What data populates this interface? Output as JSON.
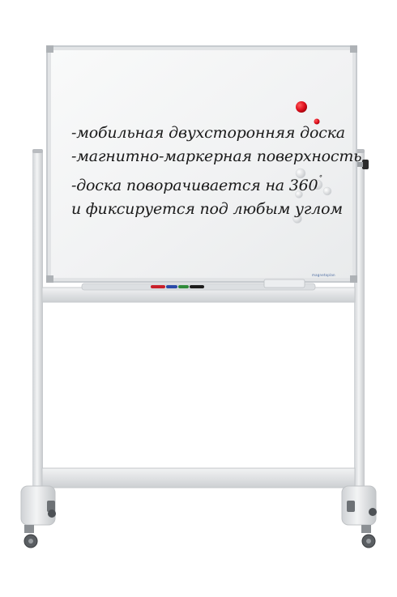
{
  "board": {
    "lines": [
      "-мобильная двухсторонняя доска",
      "-магнитно-маркерная поверхность",
      "-доска поворачивается на 360",
      "и фиксируется под любым углом"
    ],
    "degree_symbol": "˚",
    "brand_label": "magnetoplan"
  },
  "colors": {
    "frame": "#c8ccd0",
    "surface": "#f4f5f6",
    "stand": "#e3e5e7",
    "red_magnet": "#e0101e",
    "text": "#1a1a1a"
  },
  "icons": {
    "magnets": "magnet-icon",
    "markers": "marker-icon",
    "eraser": "eraser-icon",
    "wheels": "caster-wheel-icon"
  }
}
